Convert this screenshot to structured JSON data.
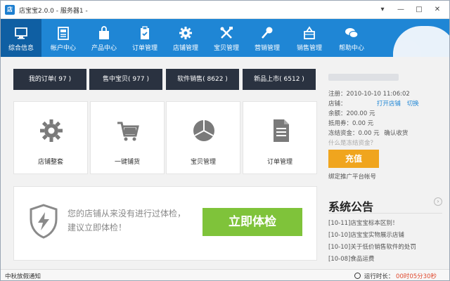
{
  "window": {
    "title": "店宝宝2.0.0 - 服务器1 -",
    "logo_text": "店",
    "controls": {
      "menu": "▾",
      "minimize": "—",
      "maximize": "□",
      "close": "✕"
    }
  },
  "nav": {
    "items": [
      {
        "label": "综合信息",
        "icon": "monitor-icon"
      },
      {
        "label": "帐户中心",
        "icon": "account-icon"
      },
      {
        "label": "产品中心",
        "icon": "bag-icon"
      },
      {
        "label": "订单管理",
        "icon": "clipboard-icon"
      },
      {
        "label": "店铺管理",
        "icon": "gear-icon"
      },
      {
        "label": "宝贝管理",
        "icon": "tools-icon"
      },
      {
        "label": "营销管理",
        "icon": "microphone-icon"
      },
      {
        "label": "销售管理",
        "icon": "basket-icon"
      },
      {
        "label": "帮助中心",
        "icon": "chat-icon"
      }
    ]
  },
  "stats": [
    {
      "label": "我的订单( 97 )"
    },
    {
      "label": "售中宝贝( 977 )"
    },
    {
      "label": "软件销售( 8622 )"
    },
    {
      "label": "新品上市( 6512 )"
    }
  ],
  "tiles": [
    {
      "label": "店铺整套",
      "icon": "gear-icon"
    },
    {
      "label": "一键铺货",
      "icon": "cart-icon"
    },
    {
      "label": "宝贝管理",
      "icon": "pie-icon"
    },
    {
      "label": "订单管理",
      "icon": "document-icon"
    }
  ],
  "check": {
    "line1": "您的店铺从来没有进行过体检，",
    "line2": "建议立即体检！",
    "button": "立即体检"
  },
  "info": {
    "register": "注册：2010-10-10 11:06:02",
    "shop_label": "店铺：",
    "open_shop": "打开店铺",
    "switch": "切换",
    "balance": "余额：200.00 元",
    "voucher": "抵用券：0.00 元",
    "frozen": "冻结资金：0.00 元",
    "confirm_receipt": "确认收货",
    "what_frozen": "什么是冻结资金？",
    "recharge": "充值",
    "bind_account": "绑定推广平台帐号"
  },
  "notices": {
    "title": "系统公告",
    "arrow": "›",
    "items": [
      "[10-11]店宝宝标本区别！",
      "[10-10]店宝宝实物展示店铺",
      "[10-10]关于低价销售软件的处罚",
      "[10-08]食品运费"
    ]
  },
  "status": {
    "left": "中秋放假通知",
    "runtime_label": "运行时长：",
    "runtime_value": "00时05分30秒"
  },
  "colors": {
    "nav_bg": "#1f86d5",
    "nav_active": "#0f5fa3",
    "stat_bg": "#2a3240",
    "check_btn": "#7fc33a",
    "recharge_btn": "#f0a51e",
    "link": "#1f86d5"
  }
}
